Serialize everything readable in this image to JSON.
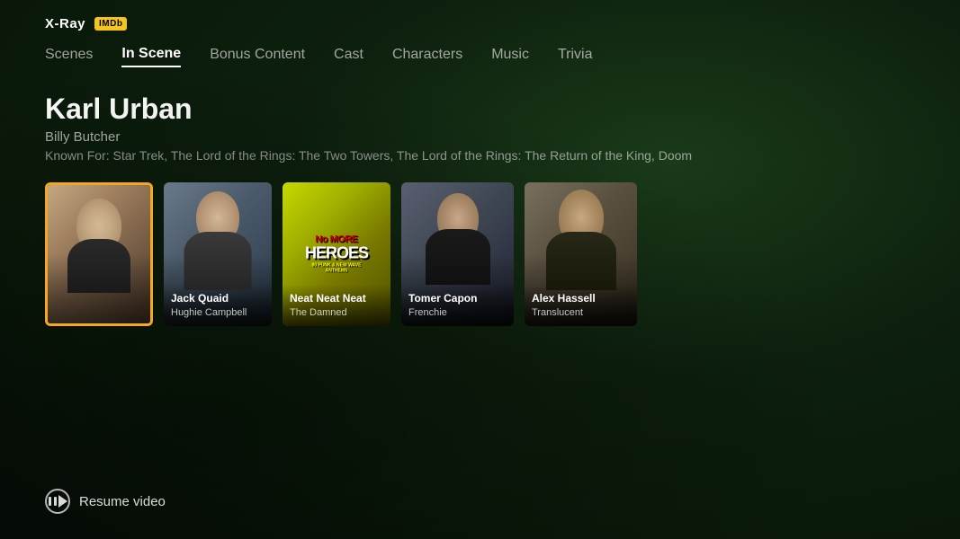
{
  "header": {
    "xray_label": "X-Ray",
    "imdb_label": "IMDb"
  },
  "nav": {
    "items": [
      {
        "id": "scenes",
        "label": "Scenes",
        "active": false
      },
      {
        "id": "in-scene",
        "label": "In Scene",
        "active": true
      },
      {
        "id": "bonus-content",
        "label": "Bonus Content",
        "active": false
      },
      {
        "id": "cast",
        "label": "Cast",
        "active": false
      },
      {
        "id": "characters",
        "label": "Characters",
        "active": false
      },
      {
        "id": "music",
        "label": "Music",
        "active": false
      },
      {
        "id": "trivia",
        "label": "Trivia",
        "active": false
      }
    ]
  },
  "actor": {
    "name": "Karl Urban",
    "role": "Billy Butcher",
    "known_for_label": "Known For:",
    "known_for": "Star Trek, The Lord of the Rings: The Two Towers, The Lord of the Rings: The Return of the King, Doom"
  },
  "cards": [
    {
      "id": "karl-urban",
      "actor_name": "Karl Urban",
      "character": "Billy Butcher",
      "focused": true,
      "type": "person"
    },
    {
      "id": "jack-quaid",
      "actor_name": "Jack Quaid",
      "character": "Hughie Campbell",
      "focused": false,
      "type": "person"
    },
    {
      "id": "neat-neat-neat",
      "actor_name": "Neat Neat Neat",
      "character": "The Damned",
      "focused": false,
      "type": "album"
    },
    {
      "id": "tomer-capon",
      "actor_name": "Tomer Capon",
      "character": "Frenchie",
      "focused": false,
      "type": "person"
    },
    {
      "id": "alex-hassell",
      "actor_name": "Alex Hassell",
      "character": "Translucent",
      "focused": false,
      "type": "person"
    }
  ],
  "resume": {
    "label": "Resume video"
  },
  "album_text": {
    "no_more": "No MORE",
    "heroes": "HEROES",
    "subtitle": "80 PUNK & NEW WAVE ANTHEMS"
  }
}
